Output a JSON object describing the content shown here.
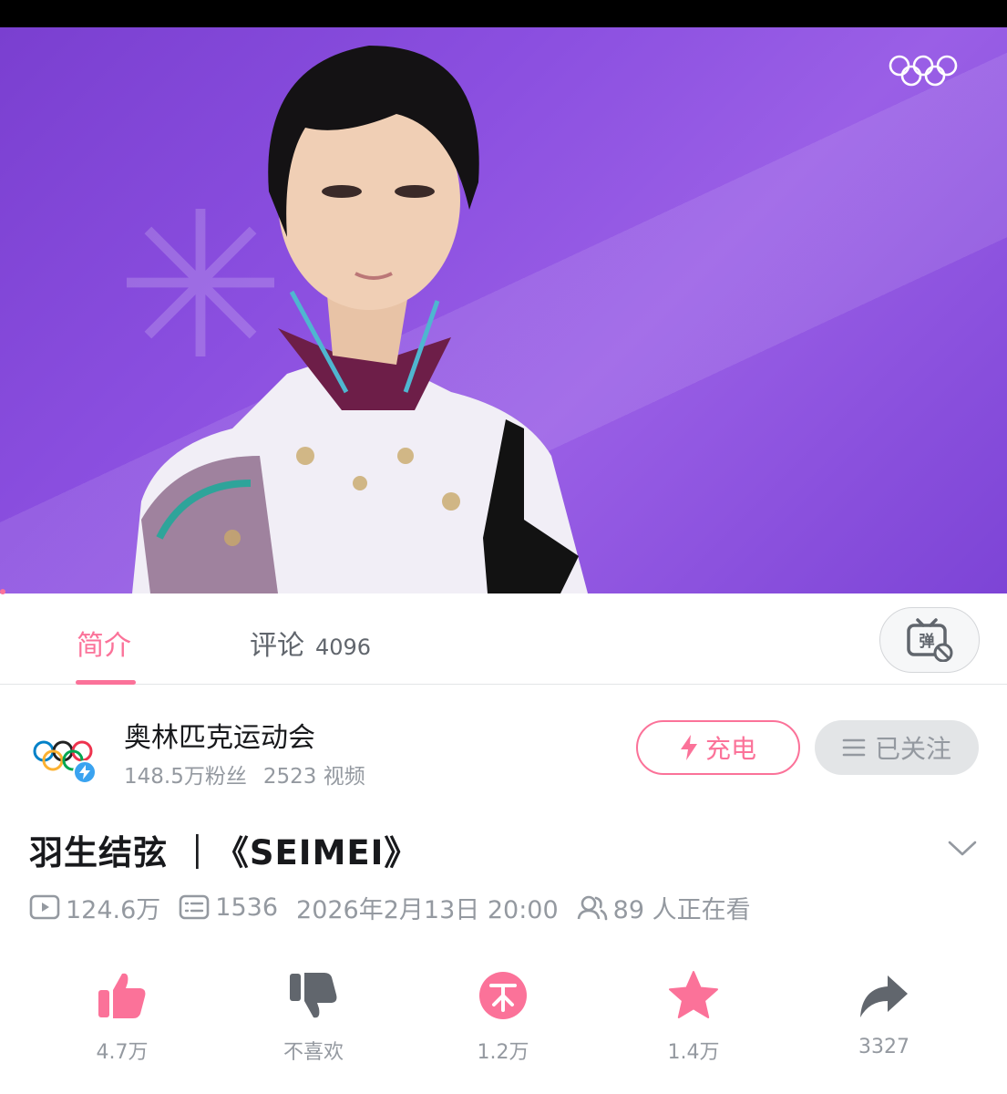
{
  "player": {
    "watermark": "olympic-rings"
  },
  "tabs": {
    "intro_label": "简介",
    "comments_label": "评论",
    "comments_count": "4096",
    "danmaku_icon": "danmaku-off-icon"
  },
  "uploader": {
    "name": "奥林匹克运动会",
    "followers": "148.5万粉丝",
    "videos": "2523 视频",
    "charge_label": "充电",
    "follow_label": "已关注"
  },
  "video": {
    "title": "羽生结弦 ｜《SEIMEI》",
    "views": "124.6万",
    "danmaku_count": "1536",
    "publish_time": "2026年2月13日 20:00",
    "watching_now": "89 人正在看"
  },
  "actions": [
    {
      "name": "like",
      "label": "4.7万"
    },
    {
      "name": "dislike",
      "label": "不喜欢"
    },
    {
      "name": "coin",
      "label": "1.2万"
    },
    {
      "name": "favorite",
      "label": "1.4万"
    },
    {
      "name": "share",
      "label": "3327"
    }
  ],
  "colors": {
    "accent": "#fb7299",
    "muted": "#9499a0",
    "dark_icon": "#61666d",
    "verify": "#3aa3f0"
  }
}
